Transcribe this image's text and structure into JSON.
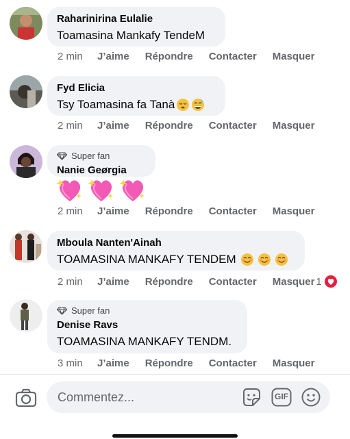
{
  "comments": [
    {
      "name": "Raharinirina Eulalie",
      "text": "Toamasina Mankafy TendeM",
      "badge": "",
      "time": "2 min"
    },
    {
      "name": "Fyd Elicia",
      "text": "Tsy Toamasina fa Tanà",
      "badge": "",
      "time": "2 min"
    },
    {
      "name": "Nanie Geørgia",
      "text": "",
      "badge": "Super fan",
      "time": "2 min"
    },
    {
      "name": "Mboula Nanten'Ainah",
      "text": "TOAMASINA MANKAFY TENDEM",
      "badge": "",
      "time": "2 min",
      "reaction_count": "1"
    },
    {
      "name": "Denise Ravs",
      "text": "TOAMASINA MANKAFY TENDM.",
      "badge": "Super fan",
      "time": "3 min"
    }
  ],
  "actions": {
    "like": "J’aime",
    "reply": "Répondre",
    "contact": "Contacter",
    "hide": "Masquer"
  },
  "composer": {
    "placeholder": "Commentez...",
    "gif_label": "GIF"
  },
  "icons": [
    "camera-icon",
    "sticker-icon",
    "gif-icon",
    "smiley-icon",
    "heart-reaction-icon",
    "diamond-icon"
  ],
  "colors": {
    "bubble": "#f0f2f5",
    "secondary_text": "#65676b",
    "heart": "#e41e3f"
  }
}
